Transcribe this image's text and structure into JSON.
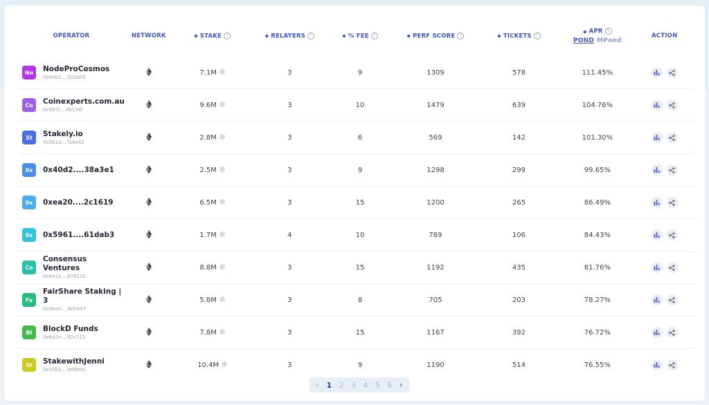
{
  "headers": {
    "operator": "OPERATOR",
    "network": "NETWORK",
    "stake": "STAKE",
    "relayers": "RELAYERS",
    "fee": "% FEE",
    "perf_score": "PERF SCORE",
    "tickets": "TICKETS",
    "apr": "APR",
    "apr_unit_active": "POND",
    "apr_unit_inactive": "MPond",
    "action": "ACTION"
  },
  "rows": [
    {
      "initials": "No",
      "color": "#b535ec",
      "name": "NodeProCosmos",
      "address": "0x0eb2....502a55",
      "stake": "7.1M",
      "relayers": "3",
      "fee": "9",
      "perf": "1309",
      "tickets": "578",
      "apr": "111.45%"
    },
    {
      "initials": "Co",
      "color": "#9d61e8",
      "name": "Coinexperts.com.au",
      "address": "0x997f....d0139f",
      "stake": "9.6M",
      "relayers": "3",
      "fee": "10",
      "perf": "1479",
      "tickets": "639",
      "apr": "104.76%"
    },
    {
      "initials": "St",
      "color": "#4a6ee6",
      "name": "Stakely.io",
      "address": "0x2b1d....f18a42",
      "stake": "2.8M",
      "relayers": "3",
      "fee": "6",
      "perf": "569",
      "tickets": "142",
      "apr": "101.30%"
    },
    {
      "initials": "0x",
      "color": "#4a8fe9",
      "name": "0x40d2....38a3e1",
      "address": "",
      "stake": "2.5M",
      "relayers": "3",
      "fee": "9",
      "perf": "1298",
      "tickets": "299",
      "apr": "99.65%"
    },
    {
      "initials": "0x",
      "color": "#46aef0",
      "name": "0xea20....2c1619",
      "address": "",
      "stake": "6.5M",
      "relayers": "3",
      "fee": "15",
      "perf": "1200",
      "tickets": "265",
      "apr": "86.49%"
    },
    {
      "initials": "0x",
      "color": "#2fc3dc",
      "name": "0x5961....61dab3",
      "address": "",
      "stake": "1.7M",
      "relayers": "4",
      "fee": "10",
      "perf": "789",
      "tickets": "106",
      "apr": "84.43%"
    },
    {
      "initials": "Co",
      "color": "#22c3a7",
      "name": "Consensus Ventures",
      "address": "0x6a1a....878131",
      "stake": "8.8M",
      "relayers": "3",
      "fee": "15",
      "perf": "1192",
      "tickets": "435",
      "apr": "81.76%"
    },
    {
      "initials": "Fa",
      "color": "#20c07c",
      "name": "FairShare Staking | 3",
      "address": "0x9be0....4e5d47",
      "stake": "5.8M",
      "relayers": "3",
      "fee": "8",
      "perf": "705",
      "tickets": "203",
      "apr": "78.27%"
    },
    {
      "initials": "Bl",
      "color": "#3fba4b",
      "name": "BlockD Funds",
      "address": "0x6a2e....82c715",
      "stake": "7.8M",
      "relayers": "3",
      "fee": "15",
      "perf": "1167",
      "tickets": "392",
      "apr": "76.72%"
    },
    {
      "initials": "St",
      "color": "#c9cc1e",
      "name": "StakewithJenni",
      "address": "0x55b1....d66601",
      "stake": "10.4M",
      "relayers": "3",
      "fee": "9",
      "perf": "1190",
      "tickets": "514",
      "apr": "76.55%"
    }
  ],
  "pagination": {
    "prev": "‹",
    "pages": [
      "1",
      "2",
      "3",
      "4",
      "5",
      "6"
    ],
    "current": "1",
    "next": "›"
  },
  "icons": {
    "network": "ethereum-icon",
    "stake_token": "pond-token-icon",
    "action_1": "bar-chart-icon",
    "action_2": "share-icon"
  }
}
